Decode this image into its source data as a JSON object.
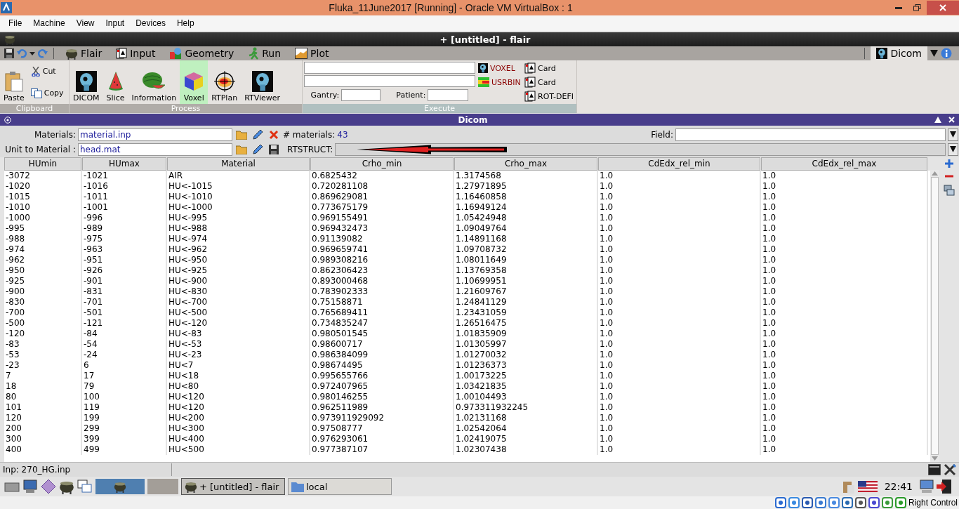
{
  "window": {
    "title": "Fluka_11June2017 [Running] - Oracle VM VirtualBox : 1"
  },
  "menu": [
    "File",
    "Machine",
    "View",
    "Input",
    "Devices",
    "Help"
  ],
  "app_title": "+ [untitled] - flair",
  "toolbar": {
    "tabs": [
      {
        "label": "Flair",
        "selected": false
      },
      {
        "label": "Input",
        "selected": false
      },
      {
        "label": "Geometry",
        "selected": false
      },
      {
        "label": "Run",
        "selected": false
      },
      {
        "label": "Plot",
        "selected": false
      }
    ],
    "right_tab": {
      "label": "Dicom",
      "selected": true
    }
  },
  "ribbon": {
    "clipboard": {
      "label": "Clipboard",
      "paste": "Paste",
      "cut": "Cut",
      "copy": "Copy"
    },
    "process": {
      "label": "Process",
      "buttons": [
        {
          "label": "DICOM",
          "selected": false
        },
        {
          "label": "Slice",
          "selected": false
        },
        {
          "label": "Information",
          "selected": false
        },
        {
          "label": "Voxel",
          "selected": true
        },
        {
          "label": "RTPlan",
          "selected": false
        },
        {
          "label": "RTViewer",
          "selected": false
        }
      ]
    },
    "execute": {
      "label": "Execute",
      "gantry_label": "Gantry:",
      "patient_label": "Patient:",
      "links": [
        "VOXEL",
        "USRBIN"
      ],
      "cards": [
        "Card",
        "Card",
        "ROT-DEFI"
      ]
    }
  },
  "panel": {
    "title": "Dicom",
    "materials_label": "Materials:",
    "materials_value": "material.inp",
    "count_label": "# materials:",
    "count": "43",
    "field_label": "Field:",
    "unit_label": "Unit to Material :",
    "unit_value": "head.mat",
    "rtstruct_label": "RTSTRUCT:"
  },
  "table": {
    "columns": [
      "HUmin",
      "HUmax",
      "Material",
      "Crho_min",
      "Crho_max",
      "CdEdx_rel_min",
      "CdEdx_rel_max"
    ],
    "rows": [
      [
        "-3072",
        "-1021",
        "AIR",
        "0.6825432",
        "1.3174568",
        "1.0",
        "1.0"
      ],
      [
        "-1020",
        "-1016",
        "HU<-1015",
        "0.720281108",
        "1.27971895",
        "1.0",
        "1.0"
      ],
      [
        "-1015",
        "-1011",
        "HU<-1010",
        "0.869629081",
        "1.16460858",
        "1.0",
        "1.0"
      ],
      [
        "-1010",
        "-1001",
        "HU<-1000",
        "0.773675179",
        "1.16949124",
        "1.0",
        "1.0"
      ],
      [
        "-1000",
        "-996",
        "HU<-995",
        "0.969155491",
        "1.05424948",
        "1.0",
        "1.0"
      ],
      [
        "-995",
        "-989",
        "HU<-988",
        "0.969432473",
        "1.09049764",
        "1.0",
        "1.0"
      ],
      [
        "-988",
        "-975",
        "HU<-974",
        "0.91139082",
        "1.14891168",
        "1.0",
        "1.0"
      ],
      [
        "-974",
        "-963",
        "HU<-962",
        "0.969659741",
        "1.09708732",
        "1.0",
        "1.0"
      ],
      [
        "-962",
        "-951",
        "HU<-950",
        "0.989308216",
        "1.08011649",
        "1.0",
        "1.0"
      ],
      [
        "-950",
        "-926",
        "HU<-925",
        "0.862306423",
        "1.13769358",
        "1.0",
        "1.0"
      ],
      [
        "-925",
        "-901",
        "HU<-900",
        "0.893000468",
        "1.10699951",
        "1.0",
        "1.0"
      ],
      [
        "-900",
        "-831",
        "HU<-830",
        "0.783902333",
        "1.21609767",
        "1.0",
        "1.0"
      ],
      [
        "-830",
        "-701",
        "HU<-700",
        "0.75158871",
        "1.24841129",
        "1.0",
        "1.0"
      ],
      [
        "-700",
        "-501",
        "HU<-500",
        "0.765689411",
        "1.23431059",
        "1.0",
        "1.0"
      ],
      [
        "-500",
        "-121",
        "HU<-120",
        "0.734835247",
        "1.26516475",
        "1.0",
        "1.0"
      ],
      [
        "-120",
        "-84",
        "HU<-83",
        "0.980501545",
        "1.01835909",
        "1.0",
        "1.0"
      ],
      [
        "-83",
        "-54",
        "HU<-53",
        "0.98600717",
        "1.01305997",
        "1.0",
        "1.0"
      ],
      [
        "-53",
        "-24",
        "HU<-23",
        "0.986384099",
        "1.01270032",
        "1.0",
        "1.0"
      ],
      [
        "-23",
        "6",
        "HU<7",
        "0.98674495",
        "1.01236373",
        "1.0",
        "1.0"
      ],
      [
        "7",
        "17",
        "HU<18",
        "0.995655766",
        "1.00173225",
        "1.0",
        "1.0"
      ],
      [
        "18",
        "79",
        "HU<80",
        "0.972407965",
        "1.03421835",
        "1.0",
        "1.0"
      ],
      [
        "80",
        "100",
        "HU<120",
        "0.980146255",
        "1.00104493",
        "1.0",
        "1.0"
      ],
      [
        "101",
        "119",
        "HU<120",
        "0.962511989",
        "0.973311932245",
        "1.0",
        "1.0"
      ],
      [
        "120",
        "199",
        "HU<200",
        "0.973911929092",
        "1.02131168",
        "1.0",
        "1.0"
      ],
      [
        "200",
        "299",
        "HU<300",
        "0.97508777",
        "1.02542064",
        "1.0",
        "1.0"
      ],
      [
        "300",
        "399",
        "HU<400",
        "0.976293061",
        "1.02419075",
        "1.0",
        "1.0"
      ],
      [
        "400",
        "499",
        "HU<500",
        "0.977387107",
        "1.02307438",
        "1.0",
        "1.0"
      ]
    ]
  },
  "status": "Inp: 270_HG.inp",
  "taskbar": {
    "tasks": [
      {
        "label": "+ [untitled] - flair",
        "selected": true
      },
      {
        "label": "local",
        "selected": false
      }
    ],
    "clock": "22:41"
  },
  "host_key": "Right Control"
}
